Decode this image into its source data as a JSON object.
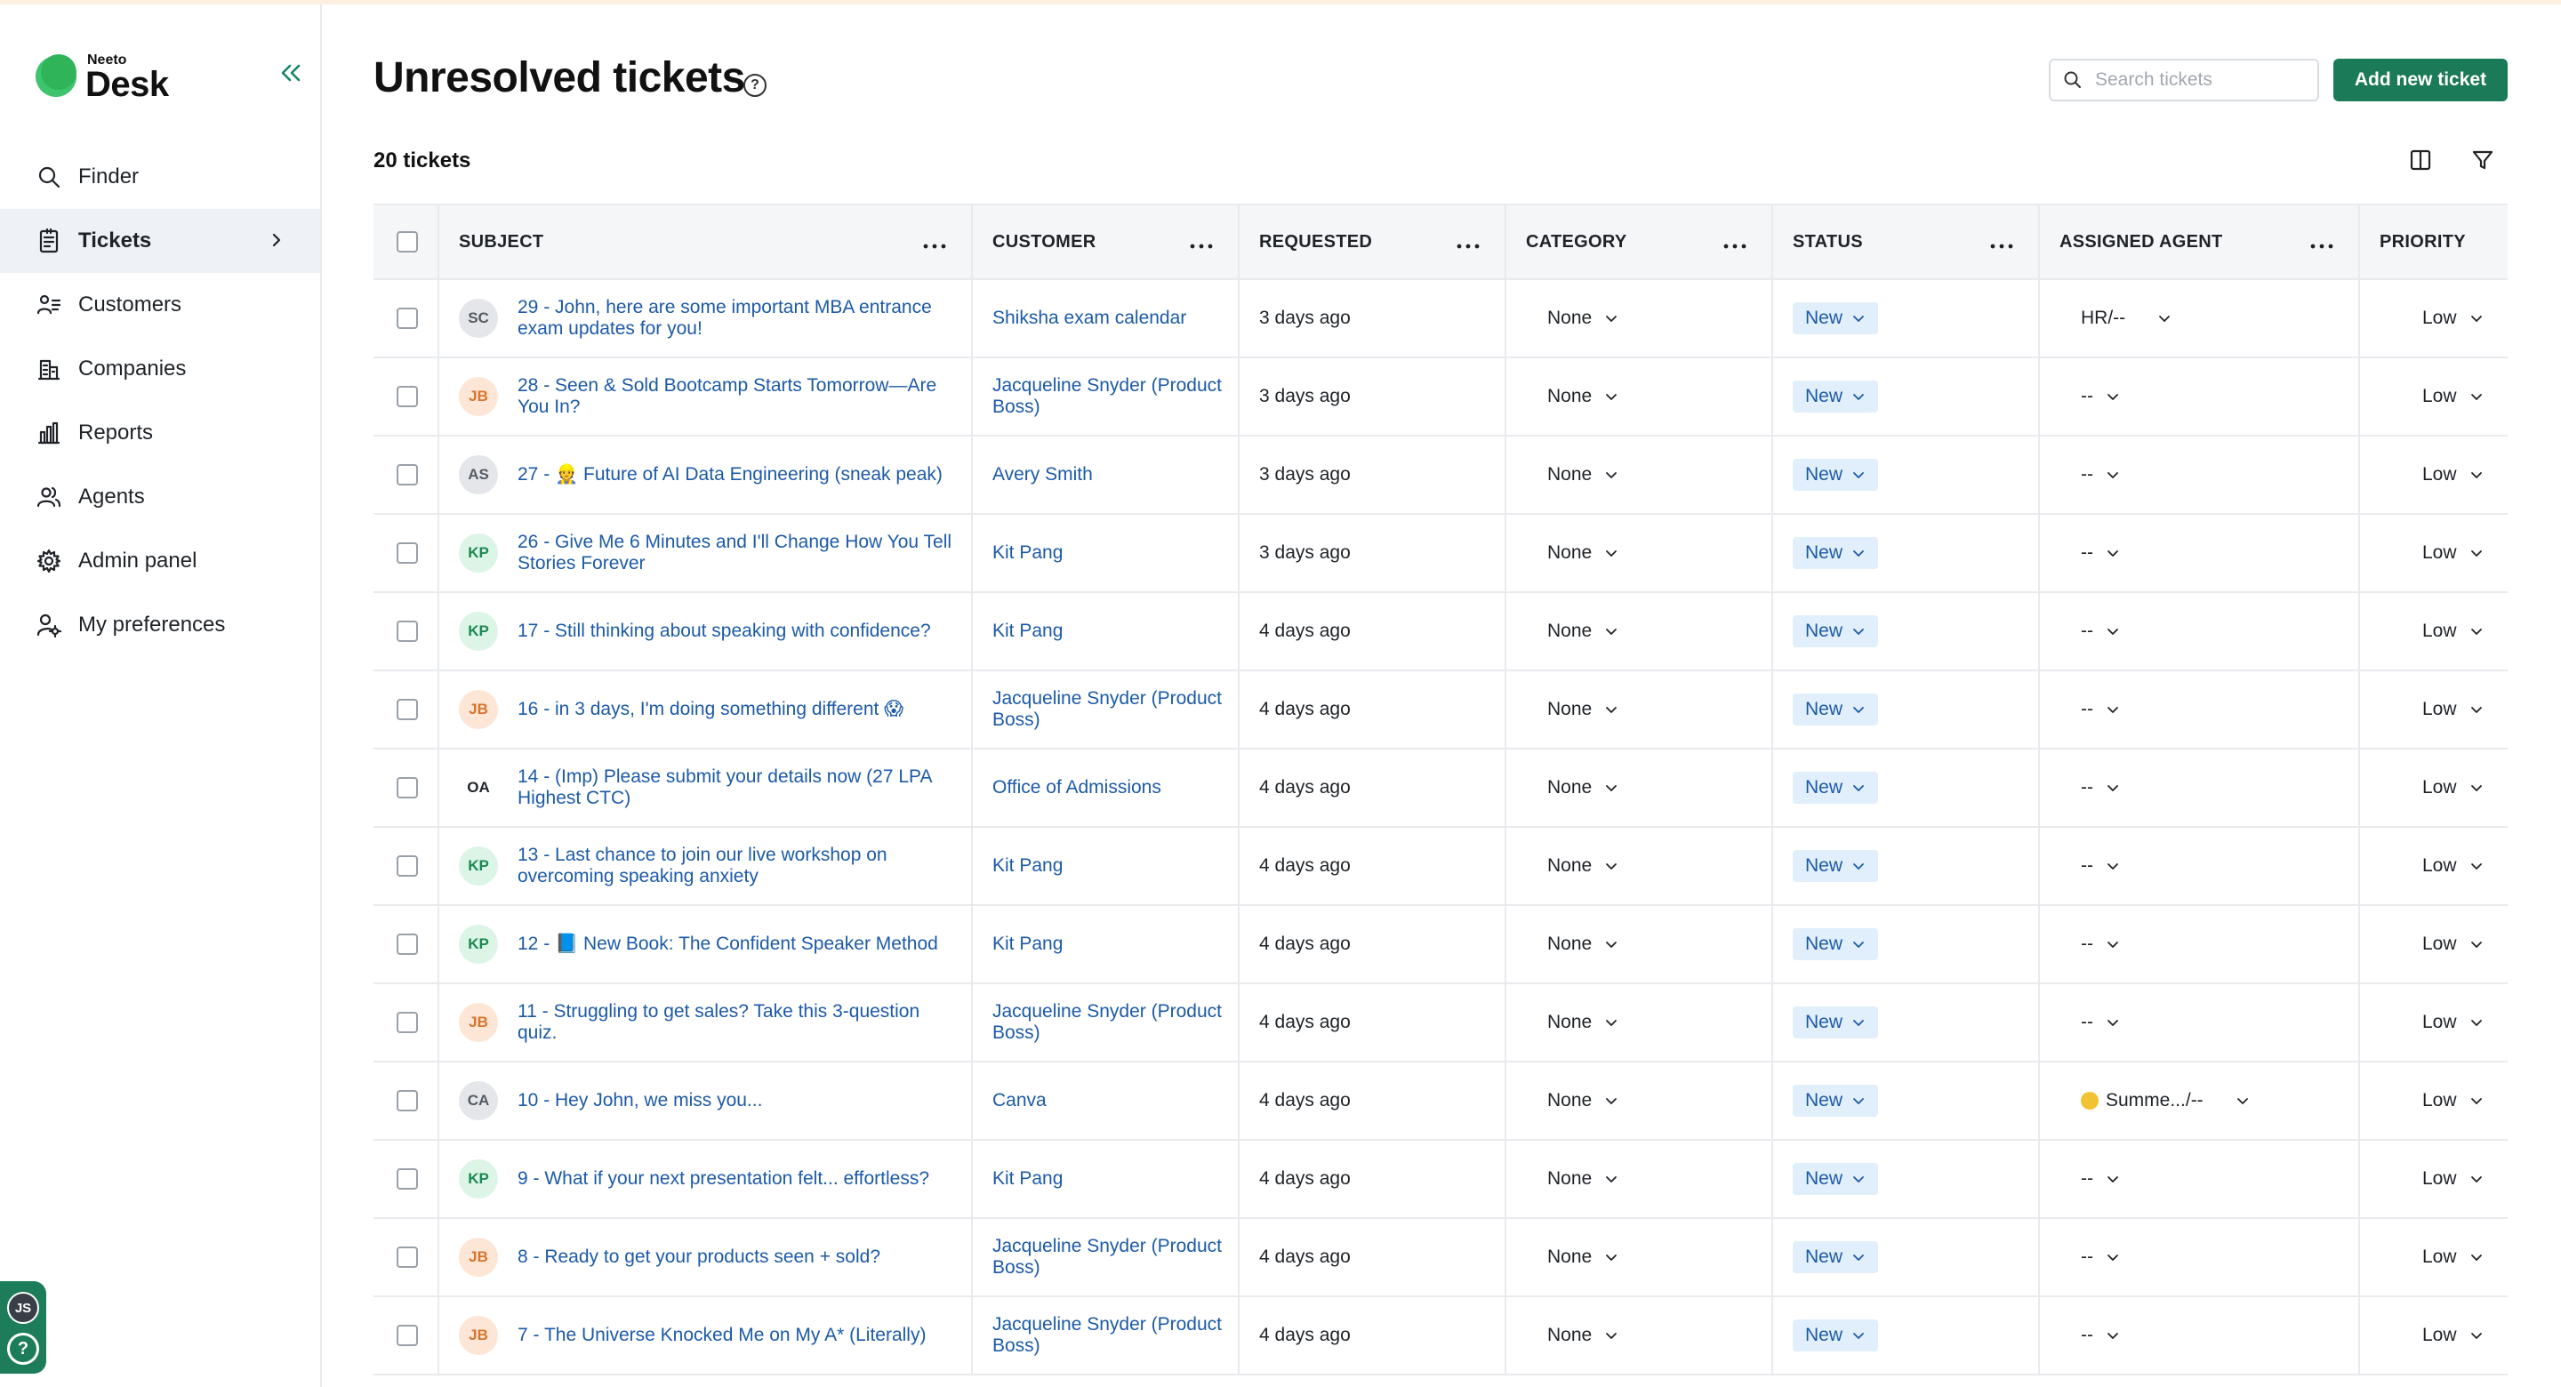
{
  "app": {
    "brand_small": "Neeto",
    "brand_big": "Desk"
  },
  "sidebar": {
    "items": [
      {
        "label": "Finder",
        "icon": "search-icon"
      },
      {
        "label": "Tickets",
        "icon": "ticket-icon",
        "active": true
      },
      {
        "label": "Customers",
        "icon": "customers-icon"
      },
      {
        "label": "Companies",
        "icon": "building-icon"
      },
      {
        "label": "Reports",
        "icon": "bar-chart-icon"
      },
      {
        "label": "Agents",
        "icon": "agents-icon"
      },
      {
        "label": "Admin panel",
        "icon": "gear-icon"
      },
      {
        "label": "My preferences",
        "icon": "user-settings-icon"
      }
    ],
    "user_initials": "JS",
    "help_label": "?"
  },
  "header": {
    "title": "Unresolved tickets",
    "search_placeholder": "Search tickets",
    "add_button": "Add new ticket",
    "count_label": "20 tickets"
  },
  "table": {
    "columns": [
      "SUBJECT",
      "CUSTOMER",
      "REQUESTED",
      "CATEGORY",
      "STATUS",
      "ASSIGNED AGENT",
      "PRIORITY"
    ],
    "rows": [
      {
        "initials": "SC",
        "avatar_bg": "#e4e6ea",
        "avatar_fg": "#555b63",
        "subject": "29 - John, here are some important MBA entrance exam updates for you!",
        "customer": "Shiksha exam calendar",
        "requested": "3 days ago",
        "category": "None",
        "status": "New",
        "agent": "HR/--",
        "priority": "Low"
      },
      {
        "initials": "JB",
        "avatar_bg": "#fde6d6",
        "avatar_fg": "#d8742e",
        "subject": "28 - Seen & Sold Bootcamp Starts Tomorrow—Are You In?",
        "customer": "Jacqueline Snyder (Product Boss)",
        "requested": "3 days ago",
        "category": "None",
        "status": "New",
        "agent": "--",
        "priority": "Low"
      },
      {
        "initials": "AS",
        "avatar_bg": "#e4e6ea",
        "avatar_fg": "#555b63",
        "subject": "27 - 👷 Future of AI Data Engineering (sneak peak)",
        "customer": "Avery Smith",
        "requested": "3 days ago",
        "category": "None",
        "status": "New",
        "agent": "--",
        "priority": "Low"
      },
      {
        "initials": "KP",
        "avatar_bg": "#dcf5e6",
        "avatar_fg": "#1b8a52",
        "subject": "26 - Give Me 6 Minutes and I'll Change How You Tell Stories Forever",
        "customer": "Kit Pang",
        "requested": "3 days ago",
        "category": "None",
        "status": "New",
        "agent": "--",
        "priority": "Low"
      },
      {
        "initials": "KP",
        "avatar_bg": "#dcf5e6",
        "avatar_fg": "#1b8a52",
        "subject": "17 - Still thinking about speaking with confidence?",
        "customer": "Kit Pang",
        "requested": "4 days ago",
        "category": "None",
        "status": "New",
        "agent": "--",
        "priority": "Low"
      },
      {
        "initials": "JB",
        "avatar_bg": "#fde6d6",
        "avatar_fg": "#d8742e",
        "subject": "16 - in 3 days, I'm doing something different 😱",
        "customer": "Jacqueline Snyder (Product Boss)",
        "requested": "4 days ago",
        "category": "None",
        "status": "New",
        "agent": "--",
        "priority": "Low"
      },
      {
        "initials": "OA",
        "avatar_bg": "#ffffff",
        "avatar_fg": "#1f2328",
        "subject": "14 - (Imp) Please submit your details now (27 LPA Highest CTC)",
        "customer": "Office of Admissions",
        "requested": "4 days ago",
        "category": "None",
        "status": "New",
        "agent": "--",
        "priority": "Low"
      },
      {
        "initials": "KP",
        "avatar_bg": "#dcf5e6",
        "avatar_fg": "#1b8a52",
        "subject": "13 - Last chance to join our live workshop on overcoming speaking anxiety",
        "customer": "Kit Pang",
        "requested": "4 days ago",
        "category": "None",
        "status": "New",
        "agent": "--",
        "priority": "Low"
      },
      {
        "initials": "KP",
        "avatar_bg": "#dcf5e6",
        "avatar_fg": "#1b8a52",
        "subject": "12 - 📘 New Book: The Confident Speaker Method",
        "customer": "Kit Pang",
        "requested": "4 days ago",
        "category": "None",
        "status": "New",
        "agent": "--",
        "priority": "Low"
      },
      {
        "initials": "JB",
        "avatar_bg": "#fde6d6",
        "avatar_fg": "#d8742e",
        "subject": "11 - Struggling to get sales? Take this 3-question quiz.",
        "customer": "Jacqueline Snyder (Product Boss)",
        "requested": "4 days ago",
        "category": "None",
        "status": "New",
        "agent": "--",
        "priority": "Low"
      },
      {
        "initials": "CA",
        "avatar_bg": "#e4e6ea",
        "avatar_fg": "#555b63",
        "subject": "10 - Hey John, we miss you...",
        "customer": "Canva",
        "requested": "4 days ago",
        "category": "None",
        "status": "New",
        "agent": "Summe.../--",
        "agent_smiley": true,
        "priority": "Low"
      },
      {
        "initials": "KP",
        "avatar_bg": "#dcf5e6",
        "avatar_fg": "#1b8a52",
        "subject": "9 - What if your next presentation felt... effortless?",
        "customer": "Kit Pang",
        "requested": "4 days ago",
        "category": "None",
        "status": "New",
        "agent": "--",
        "priority": "Low"
      },
      {
        "initials": "JB",
        "avatar_bg": "#fde6d6",
        "avatar_fg": "#d8742e",
        "subject": "8 - Ready to get your products seen + sold?",
        "customer": "Jacqueline Snyder (Product Boss)",
        "requested": "4 days ago",
        "category": "None",
        "status": "New",
        "agent": "--",
        "priority": "Low"
      },
      {
        "initials": "JB",
        "avatar_bg": "#fde6d6",
        "avatar_fg": "#d8742e",
        "subject": "7 - The Universe Knocked Me on My A* (Literally)",
        "customer": "Jacqueline Snyder (Product Boss)",
        "requested": "4 days ago",
        "category": "None",
        "status": "New",
        "agent": "--",
        "priority": "Low"
      }
    ]
  }
}
